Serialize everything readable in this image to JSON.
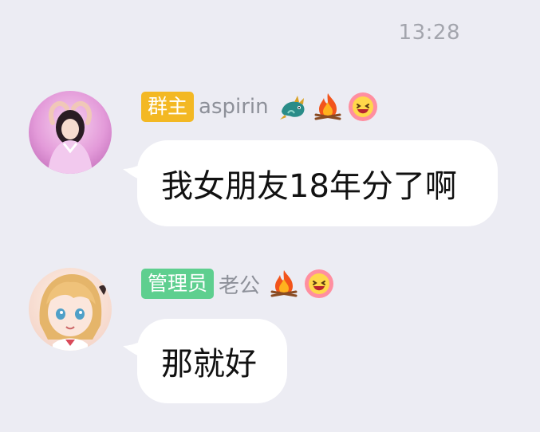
{
  "status": {
    "time": "13:28"
  },
  "messages": [
    {
      "role_badge": "群主",
      "nickname": "aspirin",
      "avatar": "avatar-photo-girl-pink",
      "medals": [
        "dragon-icon",
        "fire-icon",
        "laughing-face-icon"
      ],
      "text": "我女朋友18年分了啊"
    },
    {
      "role_badge": "管理员",
      "nickname": "老公",
      "avatar": "avatar-anime-girl-blonde",
      "medals": [
        "fire-icon",
        "laughing-face-icon"
      ],
      "text": "那就好"
    }
  ],
  "colors": {
    "background": "#ececf3",
    "owner_badge": "#f3b823",
    "admin_badge": "#5ecf8f",
    "bubble": "#ffffff",
    "nickname": "#8d9099"
  }
}
